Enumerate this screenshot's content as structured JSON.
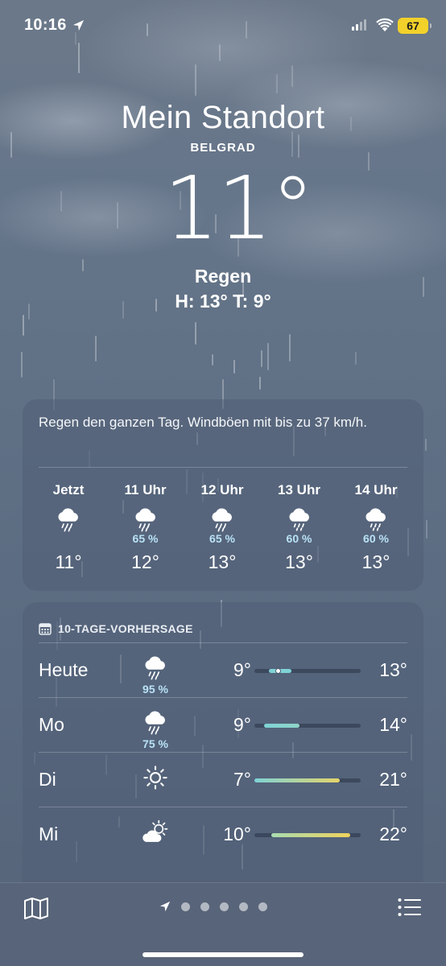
{
  "status_bar": {
    "time": "10:16",
    "battery": "67"
  },
  "location": {
    "title": "Mein Standort",
    "city": "BELGRAD"
  },
  "current": {
    "temp": "11°",
    "condition": "Regen",
    "hi_lo": "H: 13°  T: 9°"
  },
  "hourly_card": {
    "summary": "Regen den ganzen Tag. Windböen mit bis zu 37 km/h.",
    "hours": [
      {
        "label": "Jetzt",
        "icon": "rain-cloud-icon",
        "precip": "",
        "temp": "11°"
      },
      {
        "label": "11 Uhr",
        "icon": "rain-cloud-icon",
        "precip": "65 %",
        "temp": "12°"
      },
      {
        "label": "12 Uhr",
        "icon": "rain-cloud-icon",
        "precip": "65 %",
        "temp": "13°"
      },
      {
        "label": "13 Uhr",
        "icon": "drizzle-cloud-icon",
        "precip": "60 %",
        "temp": "13°"
      },
      {
        "label": "14 Uhr",
        "icon": "drizzle-cloud-icon",
        "precip": "60 %",
        "temp": "13°"
      }
    ]
  },
  "daily_card": {
    "title": "10-TAGE-VORHERSAGE",
    "days": [
      {
        "name": "Heute",
        "icon": "rain-cloud-icon",
        "precip": "95 %",
        "low": "9°",
        "high": "13°",
        "range_start": 0.14,
        "range_end": 0.35,
        "current_marker": 0.22,
        "color_from": "#7fd3d6",
        "color_to": "#7fd3d6"
      },
      {
        "name": "Mo",
        "icon": "rain-cloud-icon",
        "precip": "75 %",
        "low": "9°",
        "high": "14°",
        "range_start": 0.09,
        "range_end": 0.42,
        "color_from": "#7fd3d6",
        "color_to": "#8fd4c8"
      },
      {
        "name": "Di",
        "icon": "sun-icon",
        "precip": "",
        "low": "7°",
        "high": "21°",
        "range_start": 0.0,
        "range_end": 0.8,
        "color_from": "#7fd3d6",
        "color_to": "#e4d46a"
      },
      {
        "name": "Mi",
        "icon": "partly-cloudy-icon",
        "precip": "",
        "low": "10°",
        "high": "22°",
        "range_start": 0.16,
        "range_end": 0.9,
        "color_from": "#a8dcb0",
        "color_to": "#f0d25c"
      }
    ]
  },
  "bottom_bar": {
    "pages": 6,
    "active_page": 0
  }
}
